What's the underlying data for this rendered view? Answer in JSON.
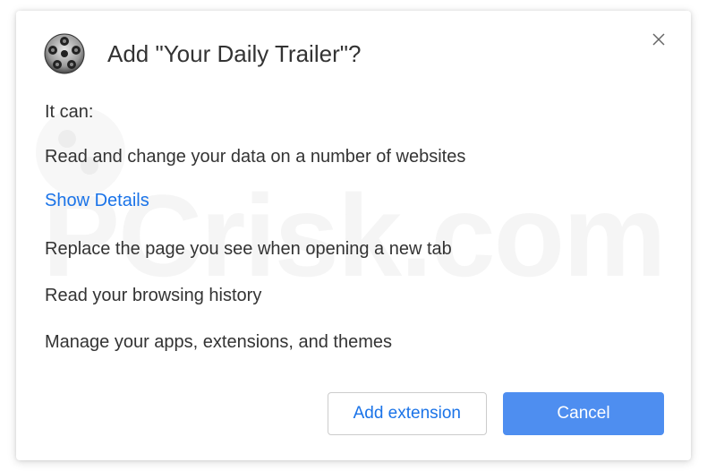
{
  "dialog": {
    "title": "Add \"Your Daily Trailer\"?",
    "intro": "It can:",
    "permissions": [
      "Read and change your data on a number of websites",
      "Replace the page you see when opening a new tab",
      "Read your browsing history",
      "Manage your apps, extensions, and themes"
    ],
    "show_details": "Show Details",
    "add_button": "Add extension",
    "cancel_button": "Cancel"
  },
  "watermark": {
    "text": "PCrisk.com"
  }
}
